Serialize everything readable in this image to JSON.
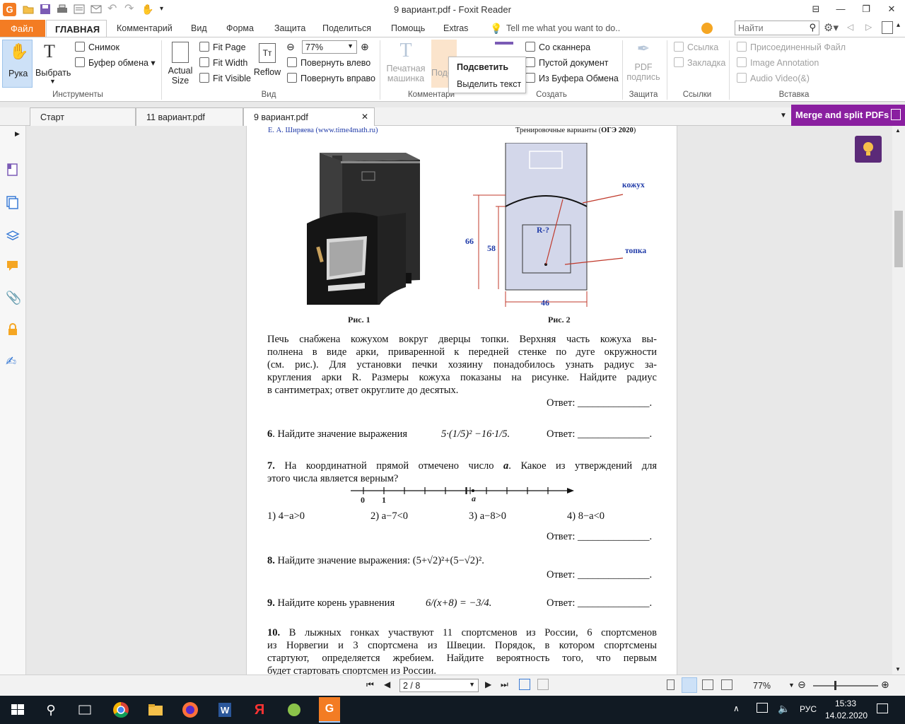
{
  "window": {
    "title": "9 вариант.pdf - Foxit Reader"
  },
  "tabs": {
    "file": "Файл",
    "home": "ГЛАВНАЯ",
    "items": [
      "Комментарий",
      "Вид",
      "Форма",
      "Защита",
      "Поделиться",
      "Помощь",
      "Extras"
    ],
    "tell_me": "Tell me what you want to do..",
    "search_placeholder": "Найти"
  },
  "ribbon": {
    "hand": "Рука",
    "select": "Выбрать",
    "snapshot": "Снимок",
    "clipboard": "Буфер обмена",
    "tools_group": "Инструменты",
    "actual_size_1": "Actual",
    "actual_size_2": "Size",
    "fit_page": "Fit Page",
    "fit_width": "Fit Width",
    "fit_visible": "Fit Visible",
    "reflow": "Reflow",
    "zoom_value": "77%",
    "rotate_left": "Повернуть влево",
    "rotate_right": "Повернуть вправо",
    "view_group": "Вид",
    "typewriter_1": "Печатная",
    "typewriter_2": "машинка",
    "highlight_partial": "Подс",
    "comment_group": "Комментари",
    "from_scanner": "Со сканнера",
    "blank_doc": "Пустой документ",
    "from_clipboard": "Из Буфера Обмена",
    "create_group": "Создать",
    "pdf_sign_1": "PDF",
    "pdf_sign_2": "подпись",
    "protect_group": "Защита",
    "link": "Ссылка",
    "bookmark": "Закладка",
    "links_group": "Ссылки",
    "attached_file": "Присоединенный Файл",
    "image_annotation": "Image Annotation",
    "audio_video": "Audio  Video(&)",
    "insert_group": "Вставка",
    "tooltip_highlight": "Подсветить",
    "tooltip_select_text": "Выделить текст"
  },
  "doc_tabs": [
    "Старт",
    "11 вариант.pdf",
    "9 вариант.pdf"
  ],
  "merge_banner": "Merge and split PDFs",
  "page": {
    "header_left": "Е. А. Ширяева (www.time4math.ru)",
    "header_right_1": "Тренировочные варианты (",
    "header_right_2": "ОГЭ 2020",
    "header_right_3": ")",
    "fig1_caption": "Рис. 1",
    "fig2_caption": "Рис. 2",
    "fig2_labels": {
      "kozhukh": "кожух",
      "topka": "топка",
      "r": "R-?",
      "h66": "66",
      "h58": "58",
      "w46": "46"
    },
    "p5_lines": [
      "Печь снабжена кожухом вокруг дверцы топки. Верхняя часть кожуха вы-",
      "полнена в виде арки, приваренной к передней стенке по дуге окружности",
      "(см. рис.). Для установки печки хозяину понадобилось узнать радиус за-",
      "кругления арки R. Размеры кожуха показаны на рисунке. Найдите радиус",
      "в сантиметрах; ответ округлите до десятых."
    ],
    "answer": "Ответ: ______________.",
    "q6_num": "6",
    "q6_text": ". Найдите значение выражения",
    "q6_expr": "5·(1/5)² −16·1/5.",
    "q7_num": "7.",
    "q7_text_1": " На координатной прямой отмечено число ",
    "q7_a": "a",
    "q7_text_2": ". Какое из утверждений для",
    "q7_line2": "этого числа является верным?",
    "q7_axis": {
      "zero": "0",
      "one": "1",
      "a": "a"
    },
    "q7_options": [
      "1)  4−a>0",
      "2)  a−7<0",
      "3)  a−8>0",
      "4)  8−a<0"
    ],
    "q8_num": "8.",
    "q8_text": " Найдите значение выражения: ",
    "q8_expr": "(5+√2)²+(5−√2)².",
    "q9_num": "9.",
    "q9_text": " Найдите корень уравнения",
    "q9_expr": "6/(x+8) = −3/4.",
    "q10_num": "10.",
    "q10_lines": [
      " В лыжных гонках участвуют 11 спортсменов из России, 6 спортсменов",
      "из Норвегии и 3 спортсмена из Швеции. Порядок, в котором спортсмены",
      "стартуют, определяется жребием. Найдите вероятность того, что первым",
      "будет стартовать спортсмен из России."
    ]
  },
  "status": {
    "page_field": "2 / 8",
    "zoom": "77%"
  },
  "taskbar": {
    "lang": "РУС",
    "time": "15:33",
    "date": "14.02.2020"
  }
}
